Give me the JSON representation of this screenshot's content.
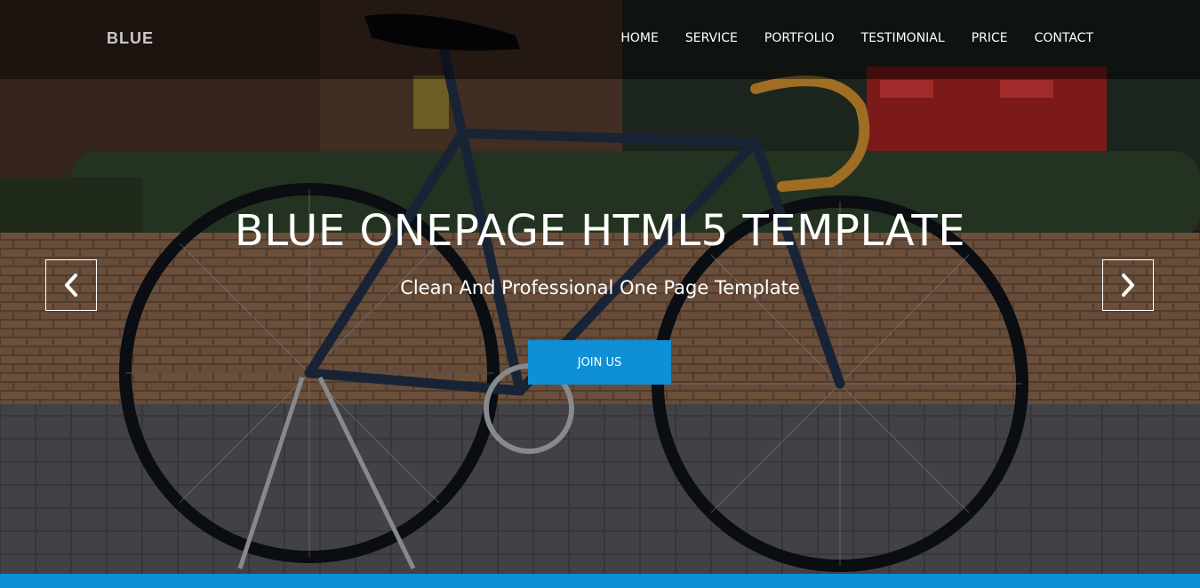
{
  "brand": {
    "logo_text": "BLUE"
  },
  "nav": {
    "items": [
      {
        "label": "HOME"
      },
      {
        "label": "SERVICE"
      },
      {
        "label": "PORTFOLIO"
      },
      {
        "label": "TESTIMONIAL"
      },
      {
        "label": "PRICE"
      },
      {
        "label": "CONTACT"
      }
    ]
  },
  "hero": {
    "title": "BLUE ONEPAGE HTML5 TEMPLATE",
    "subtitle": "Clean And Professional One Page Template",
    "cta_label": "JOIN US",
    "prev_icon": "chevron-left-icon",
    "next_icon": "chevron-right-icon",
    "background": "photo of a dark blue fixed-gear bicycle in front of a brick wall and hedge"
  },
  "colors": {
    "accent": "#0f8fd6",
    "navbar_bg": "rgba(0,0,0,0.45)",
    "text": "#ffffff",
    "brand_text": "#c9c9c9"
  }
}
